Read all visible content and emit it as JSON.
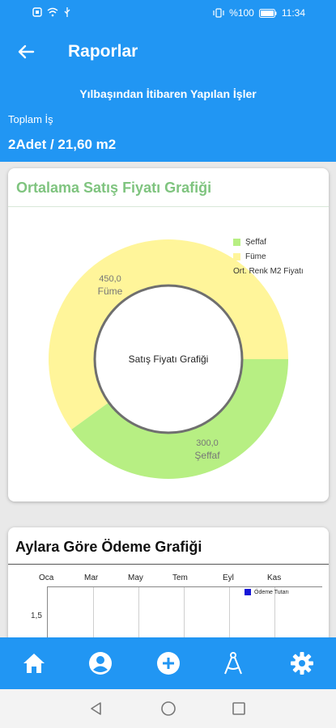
{
  "status_bar": {
    "battery": "%100",
    "time": "11:34"
  },
  "header": {
    "title": "Raporlar"
  },
  "summary": {
    "subtitle": "Yılbaşından İtibaren Yapılan İşler",
    "label": "Toplam İş",
    "value": "2Adet / 21,60 m2"
  },
  "price_chart": {
    "title": "Ortalama Satış Fiyatı Grafiği",
    "center_text": "Satış Fiyatı Grafiği",
    "legend": [
      "Şeffaf",
      "Füme",
      "Ort. Renk M2 Fiyatı"
    ],
    "colors": {
      "seffaf": "#b7ef83",
      "fume": "#fff59a"
    }
  },
  "chart_data": [
    {
      "type": "pie",
      "title": "Satış Fiyatı Grafiği",
      "categories": [
        "Şeffaf",
        "Füme"
      ],
      "values": [
        300.0,
        450.0
      ],
      "labels": [
        {
          "value": "300,0",
          "name": "Şeffaf"
        },
        {
          "value": "450,0",
          "name": "Füme"
        }
      ],
      "legend_position": "top-right"
    },
    {
      "type": "bar",
      "title": "Aylara Göre Ödeme Grafiği",
      "categories": [
        "Oca",
        "Mar",
        "May",
        "Tem",
        "Eyl",
        "Kas"
      ],
      "series": [
        {
          "name": "Ödeme Tutarı",
          "color": "#1515d8"
        }
      ],
      "y_ticks": [
        "1,5"
      ]
    }
  ],
  "payment_chart": {
    "title": "Aylara Göre Ödeme Grafiği",
    "months": [
      "Oca",
      "Mar",
      "May",
      "Tem",
      "Eyl",
      "Kas"
    ],
    "y_tick": "1,5",
    "legend": "Ödeme Tutarı"
  },
  "bottom_nav": {
    "items": [
      "home-icon",
      "account-icon",
      "add-icon",
      "compass-icon",
      "settings-icon"
    ]
  }
}
